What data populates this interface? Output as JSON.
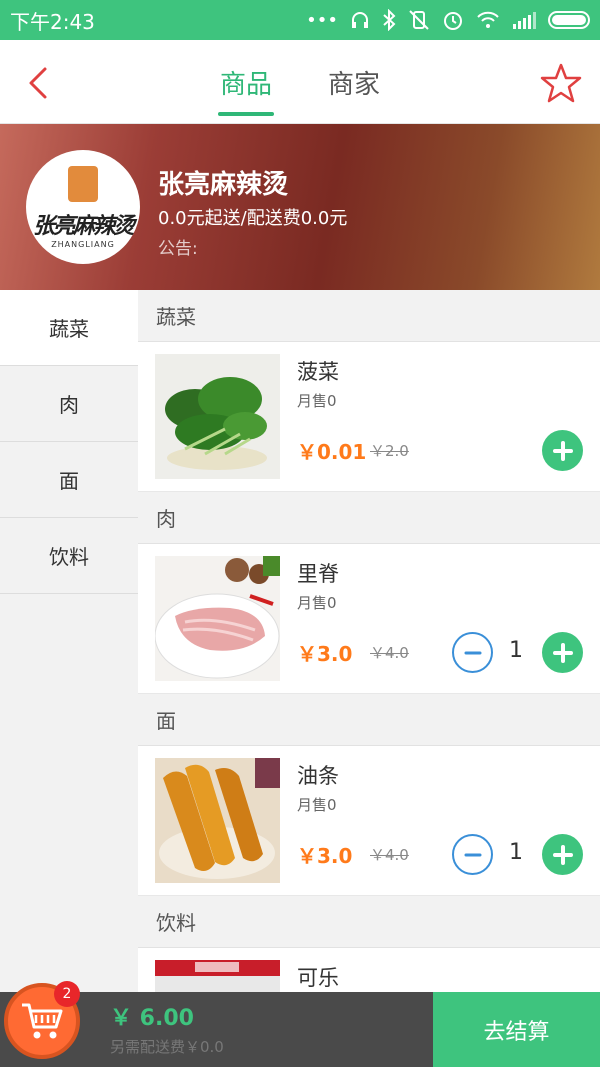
{
  "status_bar": {
    "time": "下午2:43"
  },
  "nav": {
    "tabs": [
      {
        "label": "商品",
        "active": true
      },
      {
        "label": "商家",
        "active": false
      }
    ],
    "accent_color": "#2fb777"
  },
  "shop": {
    "logo_text": "张亮麻辣烫",
    "logo_subtext": "ZHANGLIANG",
    "name": "张亮麻辣烫",
    "delivery": "0.0元起送/配送费0.0元",
    "notice": "公告:"
  },
  "categories": [
    {
      "label": "蔬菜",
      "active": true
    },
    {
      "label": "肉",
      "active": false
    },
    {
      "label": "面",
      "active": false
    },
    {
      "label": "饮料",
      "active": false
    }
  ],
  "sections": [
    {
      "title": "蔬菜",
      "products": [
        {
          "name": "菠菜",
          "sales": "月售0",
          "price": "￥0.01",
          "old_price": "￥2.0",
          "quantity": null
        }
      ]
    },
    {
      "title": "肉",
      "products": [
        {
          "name": "里脊",
          "sales": "月售0",
          "price": "￥3.0",
          "old_price": "￥4.0",
          "quantity": "1"
        }
      ]
    },
    {
      "title": "面",
      "products": [
        {
          "name": "油条",
          "sales": "月售0",
          "price": "￥3.0",
          "old_price": "￥4.0",
          "quantity": "1"
        }
      ]
    },
    {
      "title": "饮料",
      "products": [
        {
          "name": "可乐"
        }
      ]
    }
  ],
  "cart": {
    "badge_count": "2",
    "total": "￥ 6.00",
    "fee_note": "另需配送费￥0.0",
    "checkout_label": "去结算"
  }
}
